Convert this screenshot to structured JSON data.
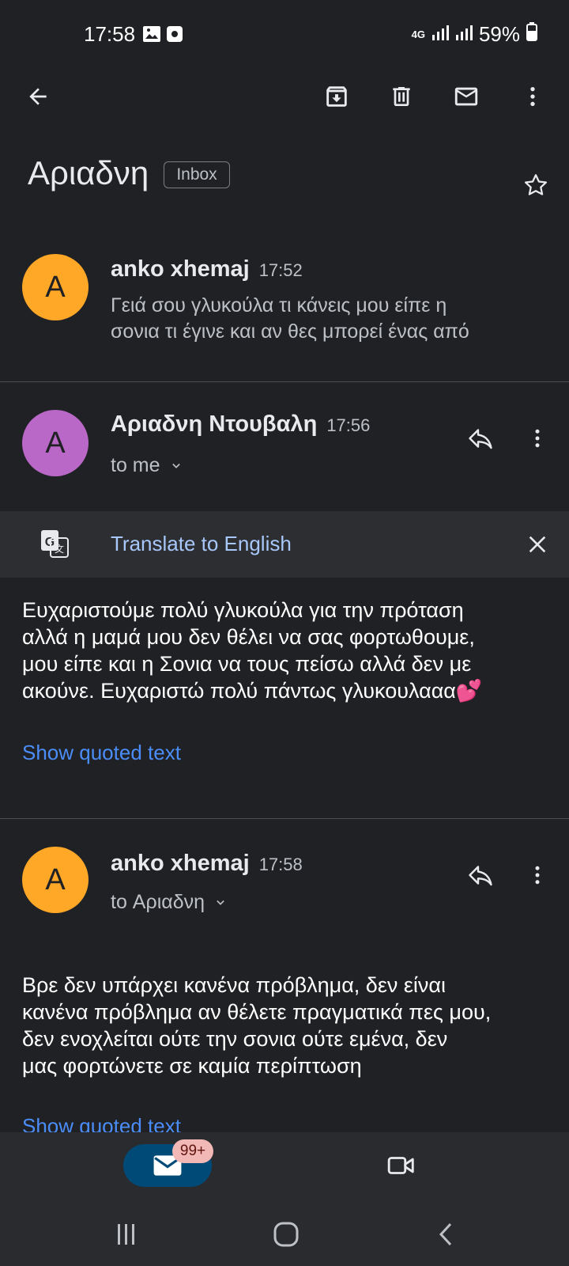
{
  "status_bar": {
    "time": "17:58",
    "network": "4G",
    "battery": "59%"
  },
  "toolbar": {
    "back": "arrow-back-icon",
    "archive": "archive-icon",
    "delete": "trash-icon",
    "mark_unread": "mail-icon",
    "more": "more-vert-icon"
  },
  "subject": {
    "title": "Αριαδνη",
    "label": "Inbox"
  },
  "messages": [
    {
      "avatar_letter": "A",
      "avatar_color": "#ffa726",
      "sender": "anko xhemaj",
      "time": "17:52",
      "snippet_line1": "Γειά σου γλυκούλα τι κάνεις μου είπε η",
      "snippet_line2": "σονια τι έγινε και αν θες μπορεί ένας από"
    },
    {
      "avatar_letter": "A",
      "avatar_color": "#ba68c8",
      "sender": "Αριαδνη Ντουβαλη",
      "time": "17:56",
      "to": "to me",
      "body_lines": [
        "Ευχαριστούμε πολύ γλυκούλα για την πρόταση",
        "αλλά η μαμά μου δεν θέλει να σας φορτωθουμε,",
        "μου είπε και η Σονια να τους πείσω αλλά δεν με",
        "ακούνε. Ευχαριστώ πολύ πάντως γλυκουλααα💕"
      ],
      "show_quoted": "Show quoted text"
    },
    {
      "avatar_letter": "A",
      "avatar_color": "#ffa726",
      "sender": "anko xhemaj",
      "time": "17:58",
      "to": "to Αριαδνη",
      "body_lines": [
        "Βρε δεν υπάρχει κανένα πρόβλημα, δεν είναι",
        "κανένα πρόβλημα αν θέλετε πραγματικά πες μου,",
        "δεν ενοχλείται ούτε την σονια ούτε εμένα, δεν",
        "μας φορτώνετε σε καμία περίπτωση"
      ],
      "show_quoted": "Show quoted text"
    }
  ],
  "translate": {
    "label": "Translate to English"
  },
  "bottom_nav": {
    "mail_badge": "99+"
  },
  "colors": {
    "background": "#202124",
    "accent_link": "#4b8df8",
    "translate_link": "#a8c7fa"
  }
}
